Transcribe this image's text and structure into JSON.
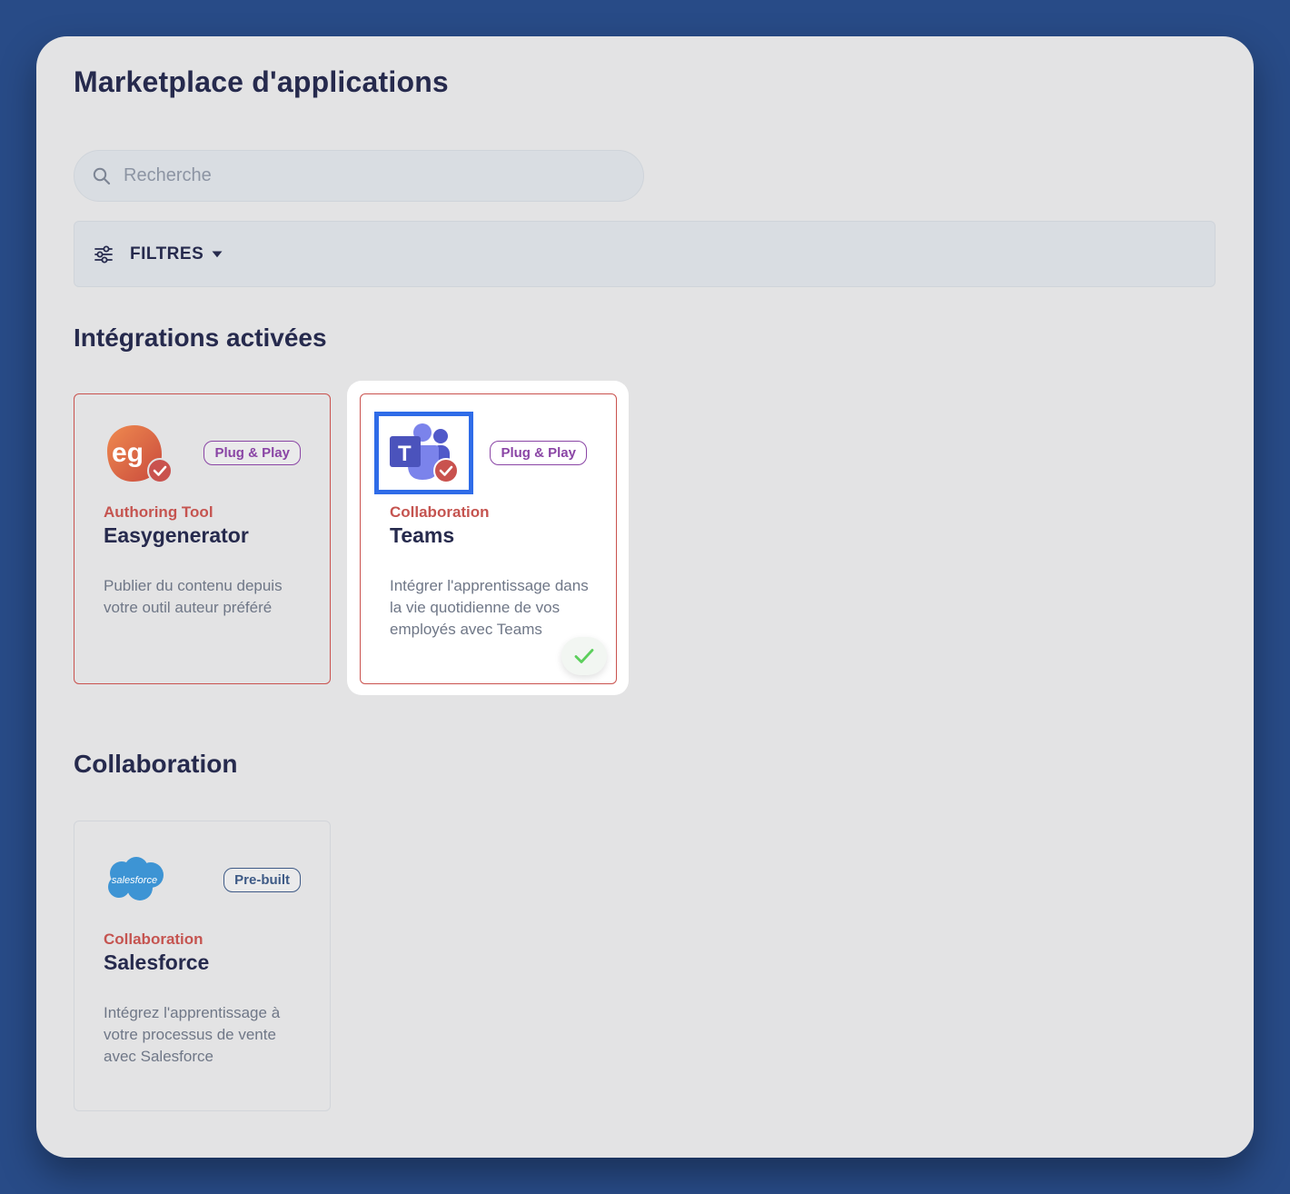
{
  "page": {
    "title": "Marketplace d'applications"
  },
  "search": {
    "placeholder": "Recherche",
    "value": ""
  },
  "filters": {
    "label": "FILTRES"
  },
  "sections": [
    {
      "title": "Intégrations activées",
      "cards": [
        {
          "logo": "easygenerator-logo",
          "logo_text": "eg",
          "badge": "Plug & Play",
          "category": "Authoring Tool",
          "name": "Easygenerator",
          "description": "Publier du contenu depuis votre outil auteur préféré",
          "enabled": true
        },
        {
          "logo": "teams-logo",
          "logo_text": "T",
          "badge": "Plug & Play",
          "category": "Collaboration",
          "name": "Teams",
          "description": "Intégrer l'apprentissage dans la vie quotidienne de vos employés avec Teams",
          "enabled": true,
          "selected": true
        }
      ]
    },
    {
      "title": "Collaboration",
      "cards": [
        {
          "logo": "salesforce-logo",
          "logo_text": "salesforce",
          "badge": "Pre-built",
          "category": "Collaboration",
          "name": "Salesforce",
          "description": "Intégrez l'apprentissage à votre processus de vente avec Salesforce",
          "enabled": false
        }
      ]
    }
  ],
  "colors": {
    "background": "#284b87",
    "panel": "#e3e3e4",
    "title": "#262a4d",
    "category": "#c55450",
    "plug_play_badge": "#8a45a5",
    "prebuilt_badge": "#3e5a86",
    "selection": "#2f6ce8",
    "success_check": "#5ccf5c"
  }
}
